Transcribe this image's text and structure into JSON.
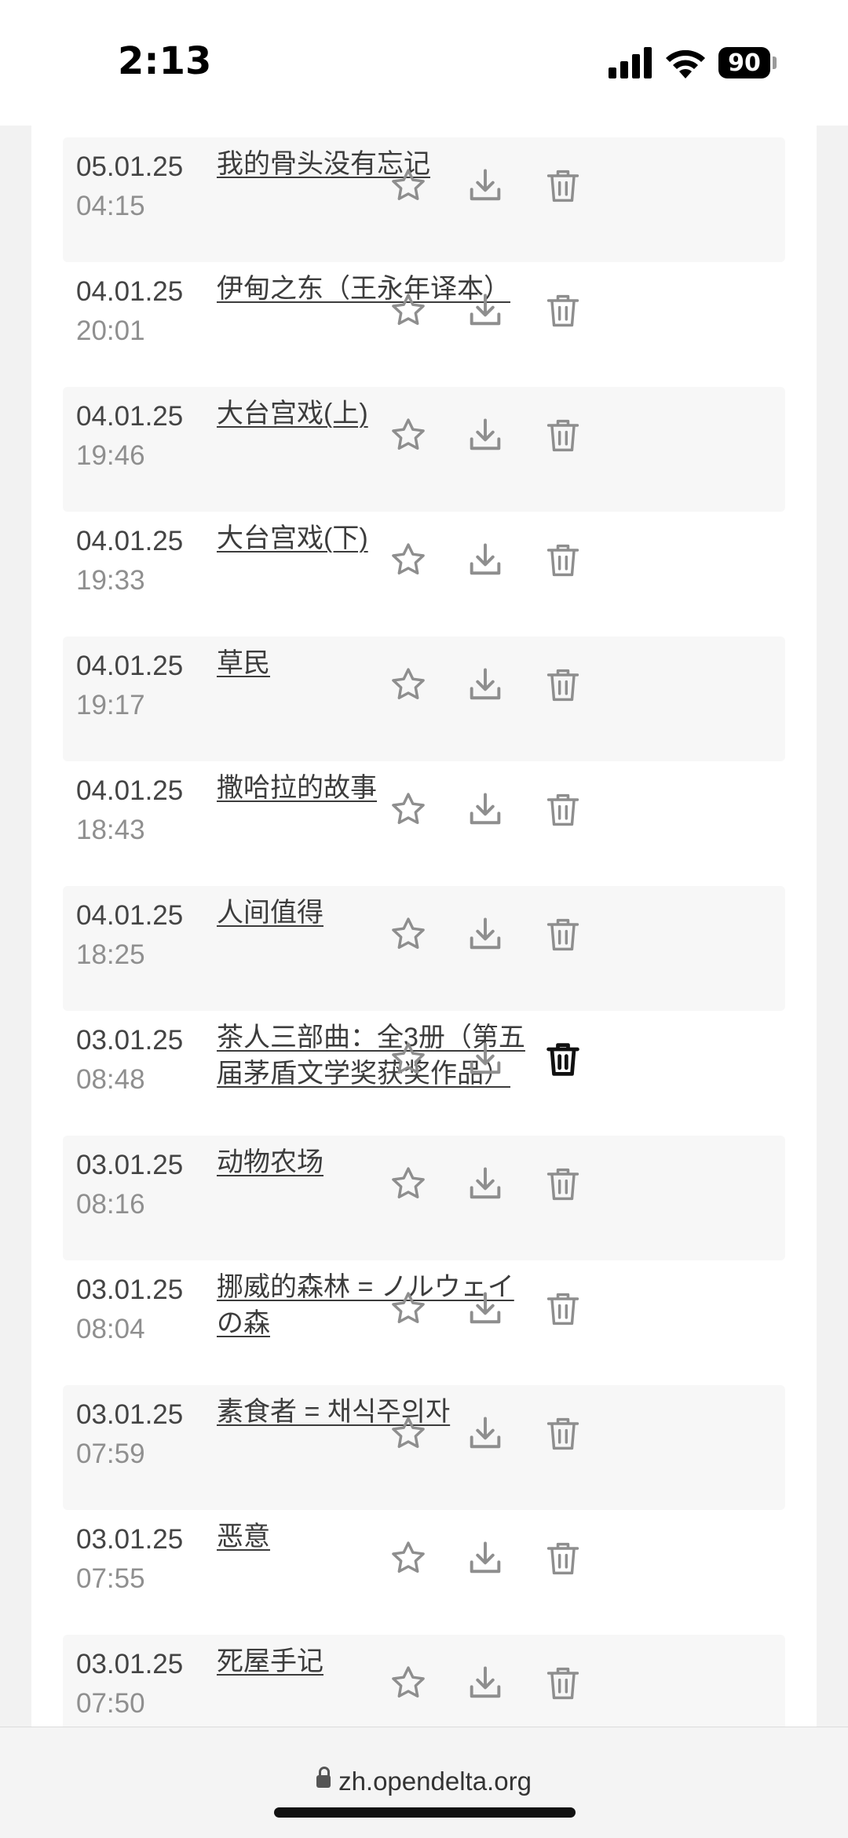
{
  "status_bar": {
    "time": "2:13",
    "battery": "90"
  },
  "entries": [
    {
      "date": "05.01.25",
      "time": "04:15",
      "title": "我的骨头没有忘记"
    },
    {
      "date": "04.01.25",
      "time": "20:01",
      "title": "伊甸之东（王永年译本）"
    },
    {
      "date": "04.01.25",
      "time": "19:46",
      "title": "大台宫戏(上)"
    },
    {
      "date": "04.01.25",
      "time": "19:33",
      "title": "大台宫戏(下)"
    },
    {
      "date": "04.01.25",
      "time": "19:17",
      "title": "草民"
    },
    {
      "date": "04.01.25",
      "time": "18:43",
      "title": "撒哈拉的故事"
    },
    {
      "date": "04.01.25",
      "time": "18:25",
      "title": "人间值得"
    },
    {
      "date": "03.01.25",
      "time": "08:48",
      "title": "茶人三部曲：全3册（第五届茅盾文学奖获奖作品）"
    },
    {
      "date": "03.01.25",
      "time": "08:16",
      "title": "动物农场"
    },
    {
      "date": "03.01.25",
      "time": "08:04",
      "title": "挪威的森林 = ノルウェイの森"
    },
    {
      "date": "03.01.25",
      "time": "07:59",
      "title": "素食者 = 채식주의자"
    },
    {
      "date": "03.01.25",
      "time": "07:55",
      "title": "恶意"
    },
    {
      "date": "03.01.25",
      "time": "07:50",
      "title": "死屋手记"
    }
  ],
  "icons": {
    "star": "star-icon",
    "download": "download-icon",
    "trash": "trash-icon"
  },
  "colors": {
    "icon_default": "#8e8e8e",
    "icon_active": "#111111",
    "row_shade": "#f7f7f7"
  },
  "active_trash_index": 7,
  "browser": {
    "url": "zh.opendelta.org"
  }
}
